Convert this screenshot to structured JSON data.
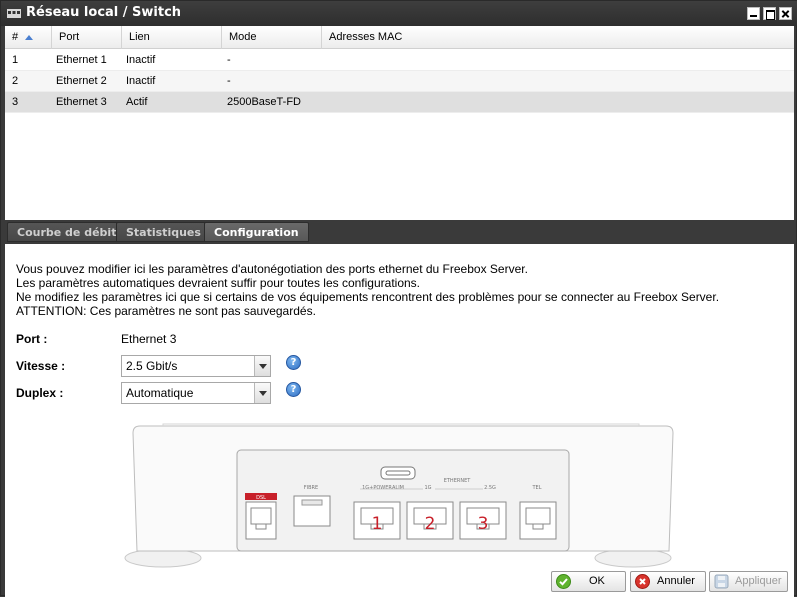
{
  "window": {
    "title": "Réseau local / Switch",
    "icon": "switch-icon"
  },
  "table": {
    "columns": [
      "#",
      "Port",
      "Lien",
      "Mode",
      "Adresses MAC"
    ],
    "sort_icon": "sort-ascending-icon",
    "rows": [
      {
        "num": "1",
        "port": "Ethernet 1",
        "lien": "Inactif",
        "mode": "-",
        "mac": ""
      },
      {
        "num": "2",
        "port": "Ethernet 2",
        "lien": "Inactif",
        "mode": "-",
        "mac": ""
      },
      {
        "num": "3",
        "port": "Ethernet 3",
        "lien": "Actif",
        "mode": "2500BaseT-FD",
        "mac": ""
      }
    ],
    "selected_row": 3
  },
  "tabs": [
    {
      "label": "Courbe de débit",
      "active": false
    },
    {
      "label": "Statistiques",
      "active": false
    },
    {
      "label": "Configuration",
      "active": true
    }
  ],
  "config": {
    "intro_lines": [
      "Vous pouvez modifier ici les paramètres d'autonégotiation des ports ethernet du Freebox Server.",
      "Les paramètres automatiques devraient suffir pour toutes les configurations.",
      "Ne modifiez les paramètres ici que si certains de vos équipements rencontrent des problèmes pour se connecter au Freebox Server.",
      "ATTENTION: Ces paramètres ne sont pas sauvegardés."
    ],
    "port_label": "Port :",
    "port_value": "Ethernet 3",
    "speed_label": "Vitesse :",
    "speed_value": "2.5 Gbit/s",
    "duplex_label": "Duplex :",
    "duplex_value": "Automatique",
    "help_glyph": "?"
  },
  "device": {
    "labels": {
      "dsl": "DSL",
      "fibre": "FIBRE",
      "alim": "ALIM",
      "ethernet": "ETHERNET",
      "power": "1G+POWER",
      "g1": "1G",
      "g25": "2.5G",
      "tel": "TEL"
    },
    "port_numbers": [
      "1",
      "2",
      "3"
    ],
    "colors": {
      "port_number": "#c8202a",
      "dsl_badge": "#c8202a"
    }
  },
  "buttons": {
    "ok": "OK",
    "cancel": "Annuler",
    "apply": "Appliquer"
  }
}
